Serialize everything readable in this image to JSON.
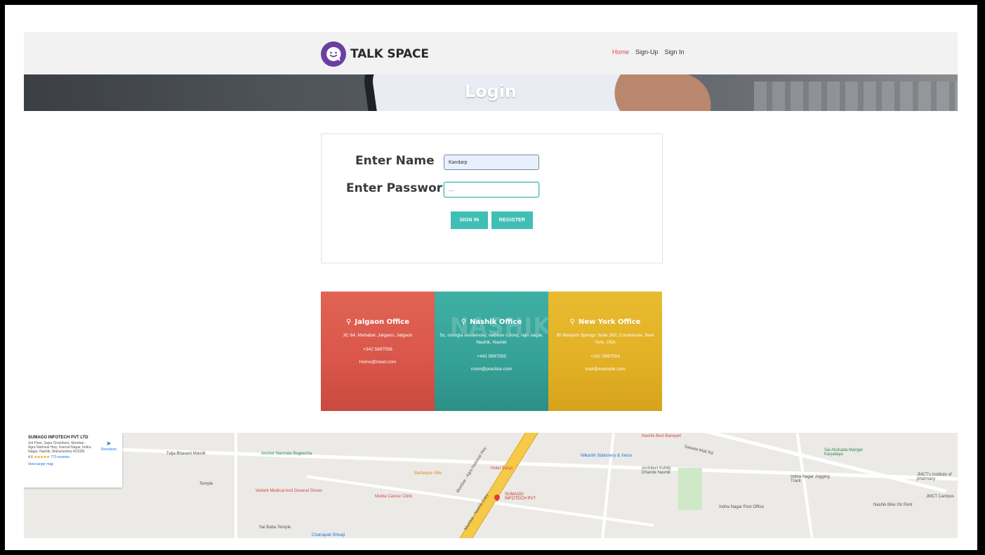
{
  "nav": {
    "brand": "TALK SPACE",
    "links": [
      {
        "label": "Home",
        "active": true
      },
      {
        "label": "Sign-Up",
        "active": false
      },
      {
        "label": "Sign In",
        "active": false
      }
    ]
  },
  "hero": {
    "title": "Login"
  },
  "form": {
    "name_label": "Enter Name",
    "name_value": "Kandarp",
    "password_label": "Enter Password",
    "password_value": "....",
    "sign_in_label": "SIGN IN",
    "register_label": "REGISTER"
  },
  "offices": [
    {
      "title": "Jalgaon Office",
      "address": "3C 64, Mahabal ,Jalgaon, Jalgaon",
      "phone": "+342 5897556",
      "email": "Home@meet.com",
      "color": "#e0584f"
    },
    {
      "title": "Nashik Office",
      "address": "Sc, roongta residencey, vaibhav colony, rajiv nagar, Nashik, Nashik",
      "phone": "+442 5897555",
      "email": "room@practice.com",
      "color": "#3aaba0",
      "watermark": "NASHIK"
    },
    {
      "title": "New York Office",
      "address": "80 Maryam Springs Suite 260, Courbevoie, New York, USA",
      "phone": "+242 5897554",
      "email": "mail@example.com",
      "color": "#e8b424"
    }
  ],
  "map": {
    "card": {
      "name": "SUMAGO INFOTECH PVT LTD",
      "address": "3rd Floor, Sajra Chambers, Mumbai - Agra National Hwy, Kamod Nagar, Indira Nagar, Nashik, Maharashtra 422009",
      "rating": "4.6",
      "stars": "★★★★★",
      "reviews": "770 reviews",
      "directions": "Directions",
      "larger_map": "View larger map"
    },
    "labels": {
      "tulja": "Tulja Bhavani Mandir",
      "anchor": "Anchor Namrata Bageecha",
      "vedant": "Vedant Medical And General Stores",
      "temple": "Temple",
      "mukta": "Mukta Cancer Clinic",
      "barbeque": "Barbeque Ville",
      "hotel": "Hotel Surya",
      "sumago": "SUMAGO INFOTECH PVT",
      "nilkanth": "Nilkanth Stationery & Xerox",
      "architect": "Architect Kshitij Dhande Nashik",
      "indira_post": "Indira Nagar Post Office",
      "sawata": "Sawata Mali Rd",
      "indira_track": "Indira Nagar Jogging Track",
      "nashik_banquet": "Nashik Best Banquet",
      "sai_akshada": "Sai Akshada Mangal Karyalaya",
      "jmct": "JMCT's Institute of pharmacy",
      "jmct_campus": "JMCT Campus",
      "nashik_bike": "Nashik Bike On Rent",
      "chatrapati": "Chatrapati Shivaji",
      "sai_baba": "Sai Baba Temple",
      "hwy": "Mumbai - Agra National Hwy",
      "nashik_expy": "Mumbai - Nashik Expy"
    }
  }
}
